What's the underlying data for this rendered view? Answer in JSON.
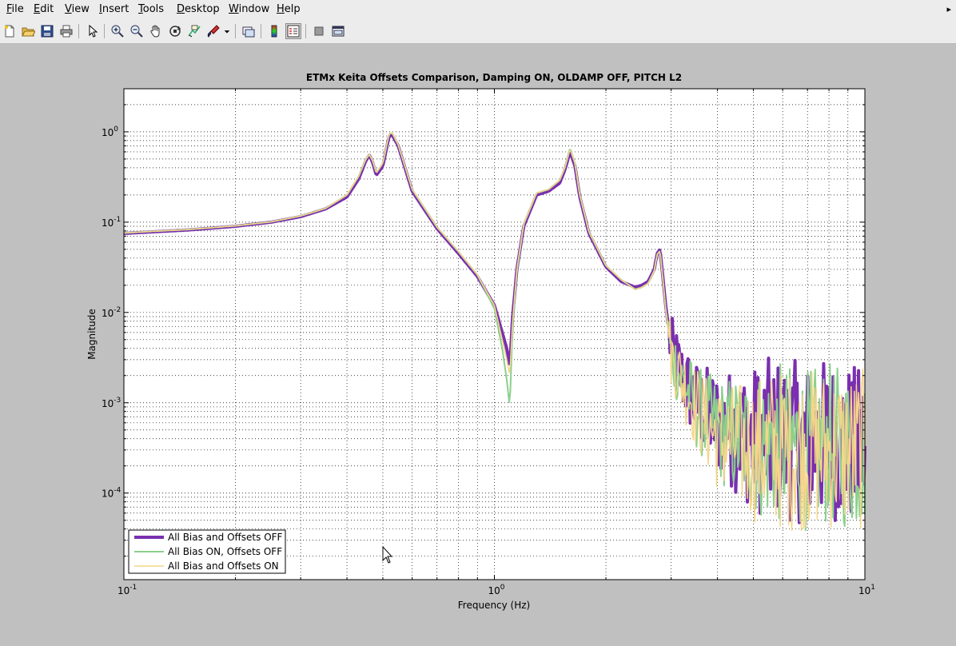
{
  "menu": {
    "items": [
      "File",
      "Edit",
      "View",
      "Insert",
      "Tools",
      "Desktop",
      "Window",
      "Help"
    ],
    "close_glyph": "▸"
  },
  "toolbar": {
    "icons": [
      "new-figure-icon",
      "open-file-icon",
      "save-icon",
      "print-icon",
      "pointer-icon",
      "zoom-in-icon",
      "zoom-out-icon",
      "pan-hand-icon",
      "rotate-3d-icon",
      "data-cursor-icon",
      "brush-icon",
      "dropdown-arrow-icon",
      "link-plot-icon",
      "colorbar-icon",
      "legend-icon",
      "hide-plot-tools-icon",
      "show-plot-tools-icon"
    ]
  },
  "colors": {
    "series1": "#7a2fb0",
    "series2": "#8ccf8c",
    "series3": "#f4d58a",
    "figure_bg": "#c0c0c0",
    "axes_bg": "#ffffff"
  },
  "chart_data": {
    "type": "line",
    "title": "ETMx Keita Offsets Comparison, Damping ON, OLDAMP OFF, PITCH L2",
    "xlabel": "Frequency (Hz)",
    "ylabel": "Magnitude",
    "xscale": "log",
    "yscale": "log",
    "xlim": [
      0.1,
      10
    ],
    "ylim": [
      1.1e-05,
      3
    ],
    "grid": true,
    "minor_grid": true,
    "legend_position": "bottom-left",
    "xticks": [
      {
        "value": 0.1,
        "base": "10",
        "exp": "-1"
      },
      {
        "value": 1,
        "base": "10",
        "exp": "0"
      },
      {
        "value": 10,
        "base": "10",
        "exp": "1"
      }
    ],
    "yticks": [
      {
        "value": 0.0001,
        "base": "10",
        "exp": "-4"
      },
      {
        "value": 0.001,
        "base": "10",
        "exp": "-3"
      },
      {
        "value": 0.01,
        "base": "10",
        "exp": "-2"
      },
      {
        "value": 0.1,
        "base": "10",
        "exp": "-1"
      },
      {
        "value": 1,
        "base": "10",
        "exp": "0"
      }
    ],
    "series": [
      {
        "name": "All Bias and Offsets OFF",
        "color": "#7a2fb0",
        "width": 4,
        "x": [
          0.1,
          0.15,
          0.2,
          0.25,
          0.3,
          0.35,
          0.4,
          0.43,
          0.45,
          0.46,
          0.47,
          0.48,
          0.5,
          0.52,
          0.53,
          0.55,
          0.6,
          0.7,
          0.8,
          0.9,
          1.0,
          1.05,
          1.08,
          1.1,
          1.12,
          1.15,
          1.2,
          1.3,
          1.4,
          1.5,
          1.55,
          1.6,
          1.65,
          1.7,
          1.8,
          2.0,
          2.2,
          2.4,
          2.5,
          2.6,
          2.7,
          2.75,
          2.8,
          2.9,
          3.0,
          3.2,
          3.5,
          4,
          5,
          6,
          7,
          8,
          9,
          10
        ],
        "y": [
          0.075,
          0.082,
          0.09,
          0.1,
          0.115,
          0.14,
          0.19,
          0.3,
          0.48,
          0.55,
          0.45,
          0.33,
          0.42,
          0.9,
          0.92,
          0.7,
          0.22,
          0.085,
          0.045,
          0.025,
          0.012,
          0.006,
          0.004,
          0.0025,
          0.009,
          0.03,
          0.09,
          0.2,
          0.22,
          0.27,
          0.38,
          0.6,
          0.42,
          0.19,
          0.075,
          0.032,
          0.022,
          0.019,
          0.02,
          0.022,
          0.03,
          0.045,
          0.05,
          0.012,
          0.004,
          0.002,
          0.001,
          0.0006,
          0.0004,
          0.0004,
          0.00035,
          0.0004,
          0.00035,
          0.0003
        ],
        "noise_from": 2.95
      },
      {
        "name": "All Bias ON, Offsets OFF",
        "color": "#8ccf8c",
        "width": 2,
        "x": [
          0.1,
          0.15,
          0.2,
          0.25,
          0.3,
          0.35,
          0.4,
          0.43,
          0.45,
          0.46,
          0.47,
          0.48,
          0.5,
          0.52,
          0.53,
          0.55,
          0.6,
          0.7,
          0.8,
          0.9,
          1.0,
          1.05,
          1.08,
          1.1,
          1.12,
          1.15,
          1.2,
          1.3,
          1.4,
          1.5,
          1.55,
          1.6,
          1.65,
          1.7,
          1.8,
          2.0,
          2.2,
          2.4,
          2.5,
          2.6,
          2.7,
          2.75,
          2.8,
          2.9,
          3.0,
          3.2,
          3.5,
          4,
          5,
          6,
          7,
          8,
          9,
          10
        ],
        "y": [
          0.076,
          0.083,
          0.091,
          0.101,
          0.117,
          0.142,
          0.2,
          0.32,
          0.5,
          0.56,
          0.47,
          0.35,
          0.45,
          0.95,
          0.97,
          0.72,
          0.23,
          0.088,
          0.047,
          0.026,
          0.011,
          0.004,
          0.0018,
          0.0009,
          0.007,
          0.028,
          0.095,
          0.21,
          0.23,
          0.29,
          0.4,
          0.66,
          0.45,
          0.2,
          0.078,
          0.033,
          0.023,
          0.018,
          0.019,
          0.021,
          0.029,
          0.044,
          0.048,
          0.011,
          0.0035,
          0.0018,
          0.0009,
          0.0005,
          0.00035,
          0.00035,
          0.0003,
          0.00035,
          0.0003,
          0.0003
        ],
        "noise_from": 2.95
      },
      {
        "name": "All Bias and Offsets ON",
        "color": "#f4d58a",
        "width": 1.5,
        "x": [
          0.1,
          0.15,
          0.2,
          0.25,
          0.3,
          0.35,
          0.4,
          0.43,
          0.45,
          0.46,
          0.47,
          0.48,
          0.5,
          0.52,
          0.53,
          0.55,
          0.6,
          0.7,
          0.8,
          0.9,
          1.0,
          1.05,
          1.08,
          1.1,
          1.12,
          1.15,
          1.2,
          1.3,
          1.4,
          1.5,
          1.55,
          1.6,
          1.65,
          1.7,
          1.8,
          2.0,
          2.2,
          2.4,
          2.5,
          2.6,
          2.7,
          2.75,
          2.8,
          2.9,
          3.0,
          3.2,
          3.5,
          4,
          5,
          6,
          7,
          8,
          9,
          10
        ],
        "y": [
          0.076,
          0.083,
          0.091,
          0.101,
          0.117,
          0.142,
          0.2,
          0.32,
          0.5,
          0.56,
          0.47,
          0.35,
          0.45,
          0.95,
          0.97,
          0.72,
          0.23,
          0.088,
          0.047,
          0.026,
          0.012,
          0.005,
          0.003,
          0.002,
          0.008,
          0.03,
          0.095,
          0.21,
          0.23,
          0.29,
          0.4,
          0.64,
          0.45,
          0.2,
          0.078,
          0.033,
          0.023,
          0.018,
          0.019,
          0.021,
          0.029,
          0.044,
          0.048,
          0.011,
          0.0035,
          0.0018,
          0.0009,
          0.0004,
          0.0003,
          0.0003,
          0.0003,
          0.0003,
          0.0003,
          0.0003
        ],
        "noise_from": 2.95
      }
    ]
  }
}
